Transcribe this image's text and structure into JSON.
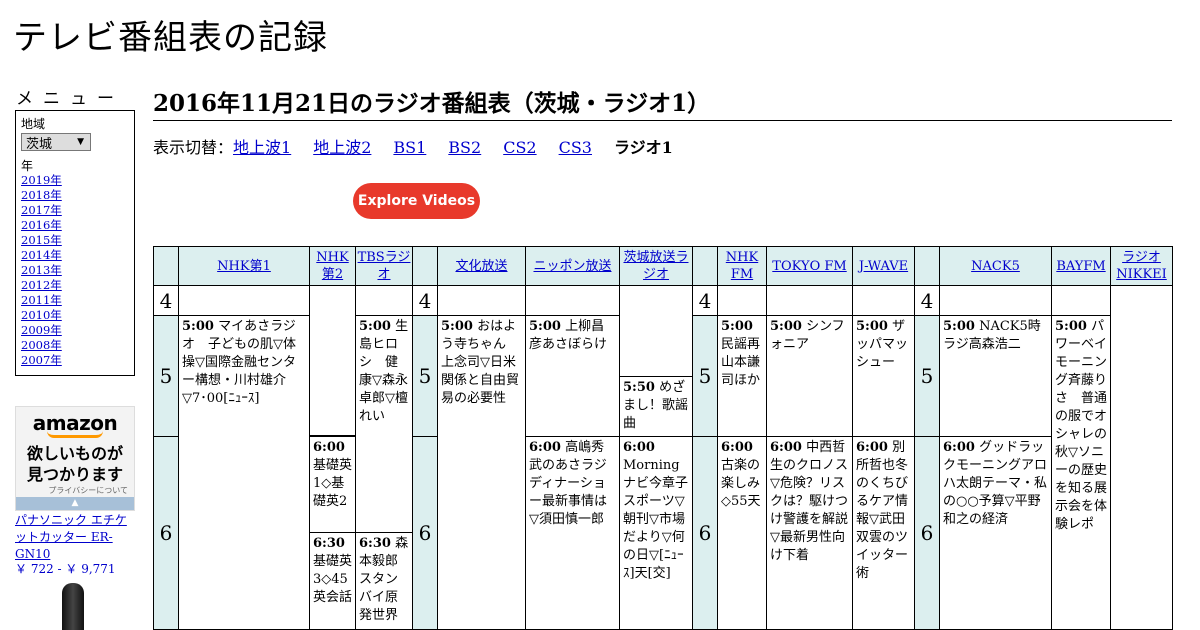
{
  "site": {
    "title": "テレビ番組表の記録"
  },
  "sidebar": {
    "menu_title": "メニュー",
    "region_label": "地域",
    "region_value": "茨城",
    "year_label": "年",
    "years": [
      "2019年",
      "2018年",
      "2017年",
      "2016年",
      "2015年",
      "2014年",
      "2013年",
      "2012年",
      "2011年",
      "2010年",
      "2009年",
      "2008年",
      "2007年"
    ]
  },
  "ad": {
    "logo": "amazon",
    "tagline_1": "欲しいものが",
    "tagline_2": "見つかります",
    "privacy": "プライバシーについて",
    "product_name": "パナソニック エチケットカッター ER-GN10",
    "product_price": "￥ 722 - ￥ 9,771"
  },
  "main": {
    "heading": "2016年11月21日のラジオ番組表（茨城・ラジオ1）",
    "switch_label": "表示切替：",
    "switch_links": [
      "地上波1",
      "地上波2",
      "BS1",
      "BS2",
      "CS2",
      "CS3"
    ],
    "switch_current": "ラジオ1",
    "explore_button": "Explore Videos"
  },
  "schedule": {
    "stations": [
      "NHK第1",
      "NHK第2",
      "TBSラジオ",
      "文化放送",
      "ニッポン放送",
      "茨城放送ラジオ",
      "NHK FM",
      "TOKYO FM",
      "J-WAVE",
      "NACK5",
      "BAYFM",
      "ラジオNIKKEI"
    ],
    "hours": [
      "4",
      "5",
      "6"
    ],
    "programs": {
      "nhk1_500": {
        "time": "5:00",
        "title": " マイあさラジオ　子どもの肌▽体操▽国際金融センター構想・川村雄介▽7･00[ﾆｭｰｽ]"
      },
      "nhk2_600": {
        "time": "6:00",
        "title": " 基礎英1◇基礎英2"
      },
      "nhk2_630": {
        "time": "6:30",
        "title": " 基礎英3◇45英会話"
      },
      "tbs_500": {
        "time": "5:00",
        "title": " 生島ヒロシ　健康▽森永卓郎▽檀れい"
      },
      "tbs_630": {
        "time": "6:30",
        "title": " 森本毅郎スタンバイ原発世界"
      },
      "bunka_500": {
        "time": "5:00",
        "title": " おはよう寺ちゃん　上念司▽日米関係と自由貿易の必要性"
      },
      "nippon_500": {
        "time": "5:00",
        "title": " 上柳昌彦あさぼらけ"
      },
      "nippon_600": {
        "time": "6:00",
        "title": " 高嶋秀武のあさラジディナーショー最新事情は▽須田慎一郎"
      },
      "ibaraki_550": {
        "time": "5:50",
        "title": " めざまし！歌謡曲"
      },
      "ibaraki_600": {
        "time": "6:00",
        "title": " Morningナビ今章子　スポーツ▽朝刊▽市場だより▽何の日▽[ﾆｭｰｽ]天[交]"
      },
      "nhkfm_500": {
        "time": "5:00",
        "title": " 民謡再山本謙司ほか"
      },
      "nhkfm_600": {
        "time": "6:00",
        "title": " 古楽の楽しみ◇55天"
      },
      "tokyofm_500": {
        "time": "5:00",
        "title": " シンフォニア"
      },
      "tokyofm_600": {
        "time": "6:00",
        "title": " 中西哲生のクロノス▽危険？リスクは？駆けつけ警護を解説▽最新男性向け下着"
      },
      "jwave_500": {
        "time": "5:00",
        "title": " ザッパマッシュー"
      },
      "jwave_600": {
        "time": "6:00",
        "title": " 別所哲也冬のくちびるケア情報▽武田双雲のツイッター術"
      },
      "nack5_500": {
        "time": "5:00",
        "title": " NACK5時ラジ高森浩二"
      },
      "nack5_600": {
        "time": "6:00",
        "title": " グッドラックモーニングアロハ太朗テーマ・私の○○予算▽平野和之の経済"
      },
      "bayfm_500": {
        "time": "5:00",
        "title": " パワーベイモーニング斉藤りさ　普通の服でオシャレの秋▽ソニーの歴史を知る展示会を体験レポ"
      }
    }
  }
}
